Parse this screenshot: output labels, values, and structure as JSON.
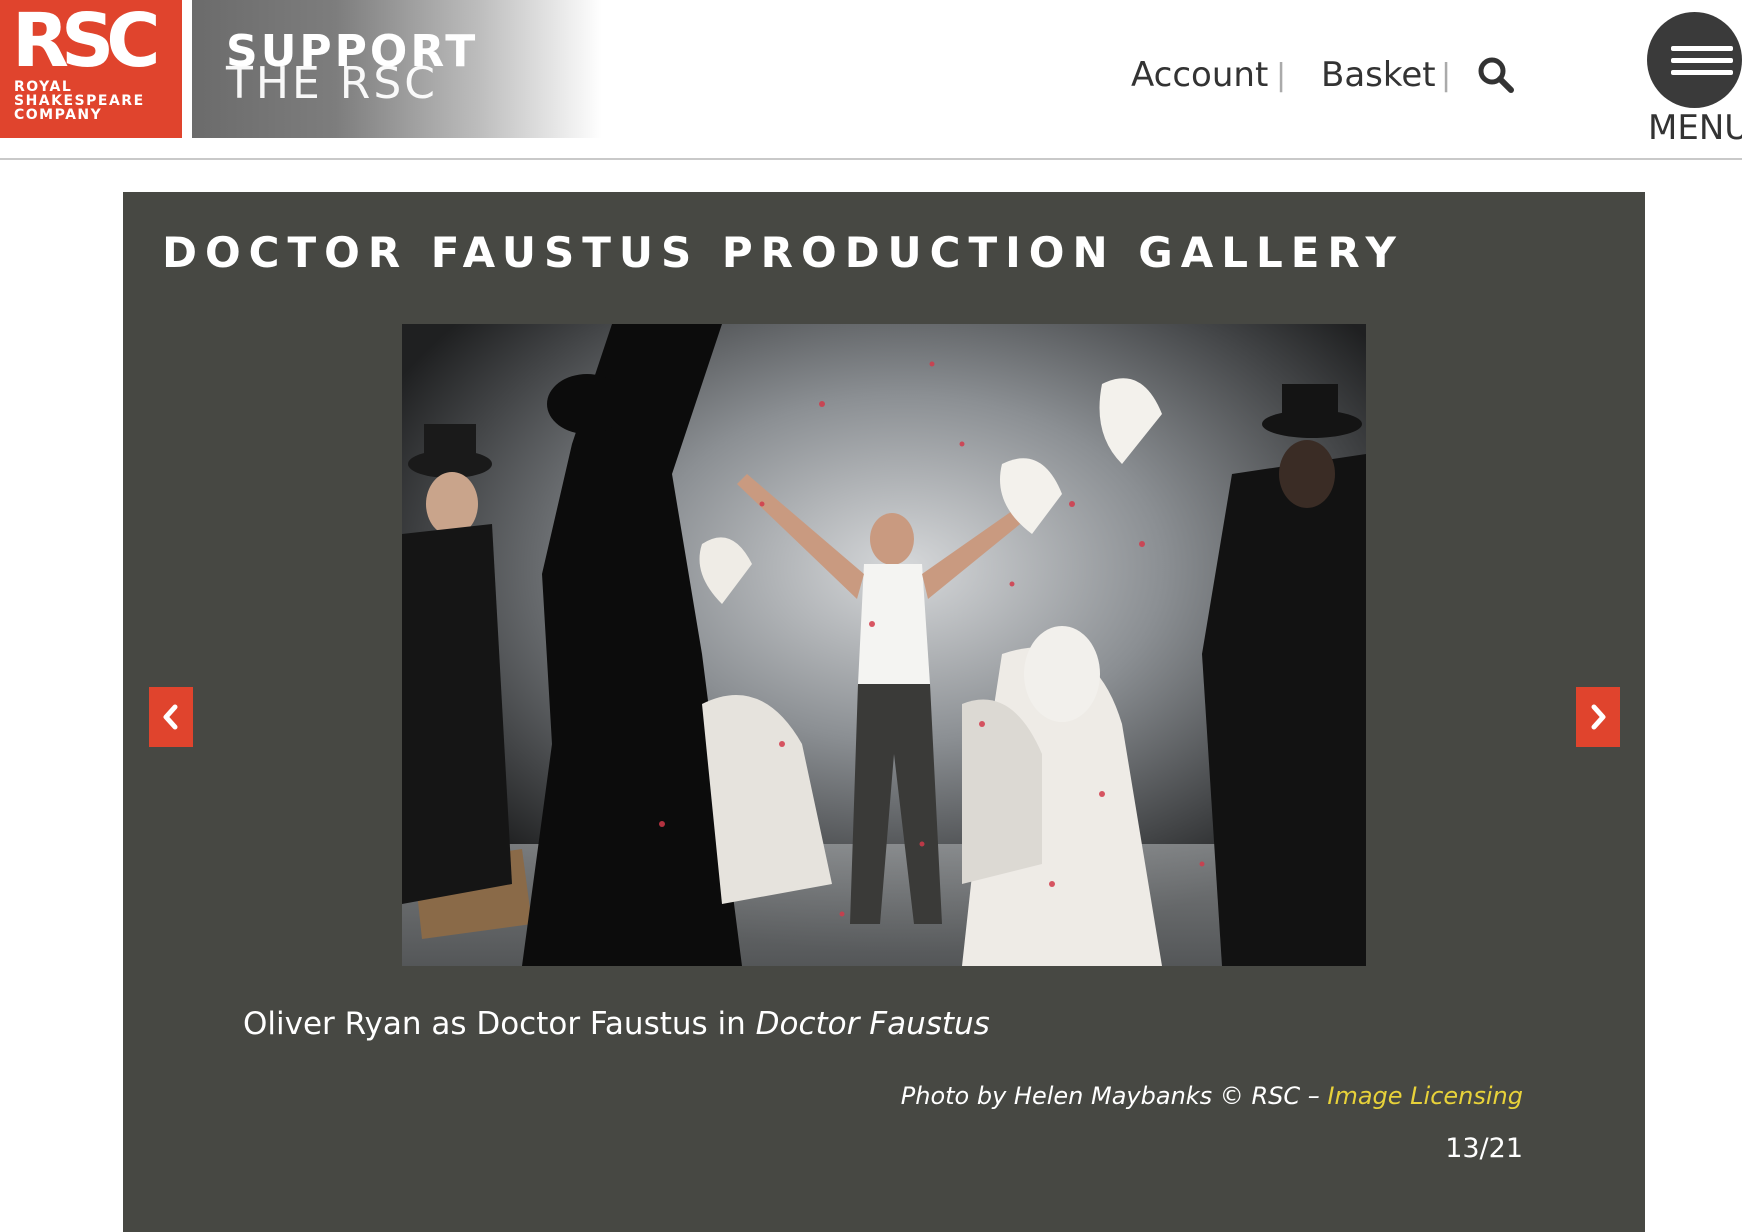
{
  "header": {
    "logo": {
      "mark": "RSC",
      "line1": "ROYAL",
      "line2": "SHAKESPEARE",
      "line3": "COMPANY",
      "color": "#e0442d"
    },
    "support": {
      "line1": "SUPPORT",
      "line2": "THE RSC"
    },
    "nav": {
      "account": "Account",
      "separator": "|",
      "basket": "Basket",
      "search_icon": "search-icon"
    },
    "menu": {
      "label": "MENU",
      "icon": "hamburger-icon"
    }
  },
  "gallery": {
    "title": "DOCTOR FAUSTUS PRODUCTION GALLERY",
    "background": "#474843",
    "photo_icon": "production-photo",
    "prev_icon": "chevron-left-icon",
    "next_icon": "chevron-right-icon",
    "arrow_color": "#e0442d",
    "caption": {
      "text": "Oliver Ryan as Doctor Faustus in ",
      "title": "Doctor Faustus"
    },
    "credit": {
      "text": "Photo by Helen Maybanks © RSC – ",
      "link": "Image Licensing",
      "link_color": "#e8d23a"
    },
    "counter": "13/21"
  }
}
